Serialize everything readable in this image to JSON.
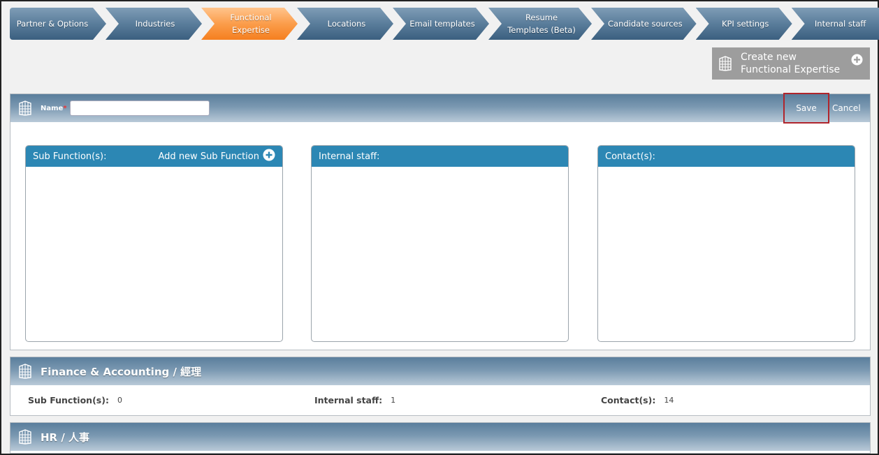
{
  "wizard": {
    "steps": [
      {
        "label": "Partner & Options"
      },
      {
        "label": "Industries"
      },
      {
        "label": "Functional Expertise"
      },
      {
        "label": "Locations"
      },
      {
        "label": "Email templates"
      },
      {
        "label": "Resume Templates (Beta)"
      },
      {
        "label": "Candidate sources"
      },
      {
        "label": "KPI settings"
      },
      {
        "label": "Internal staff"
      }
    ],
    "active_step": "Functional Expertise"
  },
  "create_button": {
    "line1": "Create new",
    "line2": "Functional Expertise"
  },
  "editor": {
    "name_label": "Name",
    "required_mark": "*",
    "name_value": "",
    "save_label": "Save",
    "cancel_label": "Cancel",
    "boxes": {
      "sub_functions": {
        "title": "Sub Function(s):",
        "add_label": "Add new Sub Function"
      },
      "internal_staff": {
        "title": "Internal staff:"
      },
      "contacts": {
        "title": "Contact(s):"
      }
    }
  },
  "items": [
    {
      "title": "Finance & Accounting / 經理",
      "sub_functions_label": "Sub Function(s):",
      "sub_functions_count": "0",
      "internal_staff_label": "Internal staff:",
      "internal_staff_count": "1",
      "contacts_label": "Contact(s):",
      "contacts_count": "14"
    },
    {
      "title": "HR / 人事"
    }
  ],
  "colors": {
    "wizard_step": "#5a7d9b",
    "wizard_active": "#fb9d4b",
    "box_header": "#2c87b4",
    "save_outline": "#b0252c",
    "create_button": "#9d9d9d"
  },
  "icons": {
    "entity": "building-icon",
    "add": "plus-circle-icon"
  }
}
